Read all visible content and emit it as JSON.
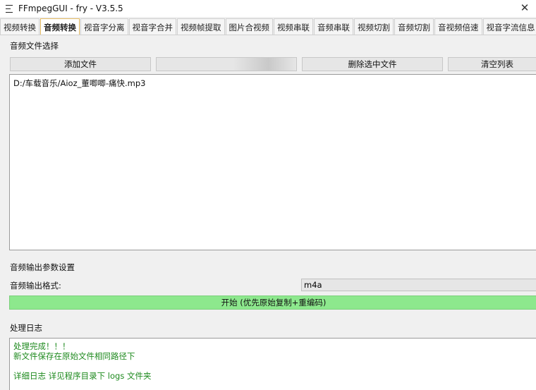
{
  "window": {
    "title": "FFmpegGUI - fry - V3.5.5",
    "close_glyph": "✕"
  },
  "tabs": [
    {
      "label": "视频转换"
    },
    {
      "label": "音频转换"
    },
    {
      "label": "视音字分离"
    },
    {
      "label": "视音字合并"
    },
    {
      "label": "视频帧提取"
    },
    {
      "label": "图片合视频"
    },
    {
      "label": "视频串联"
    },
    {
      "label": "音频串联"
    },
    {
      "label": "视频切割"
    },
    {
      "label": "音频切割"
    },
    {
      "label": "音视频倍速"
    },
    {
      "label": "视音字流信息"
    }
  ],
  "active_tab": "音频转换",
  "file_section": {
    "label": "音频文件选择",
    "add_button": "添加文件",
    "blank_button": "",
    "delete_button": "删除选中文件",
    "clear_button": "清空列表",
    "files": [
      "D:/车载音乐/Aioz_董唧唧-痛快.mp3"
    ]
  },
  "output_section": {
    "label": "音频输出参数设置",
    "format_label": "音频输出格式:",
    "format_value": "m4a"
  },
  "start_button": "开始 (优先原始复制+重编码)",
  "log_section": {
    "label": "处理日志",
    "lines": [
      "处理完成！！！",
      "新文件保存在原始文件相同路径下",
      "",
      "详细日志 详见程序目录下 logs 文件夹"
    ]
  },
  "colors": {
    "start_button_bg": "#8de88d",
    "log_text": "#1e8a1e",
    "active_tab_border": "#e2b860"
  }
}
